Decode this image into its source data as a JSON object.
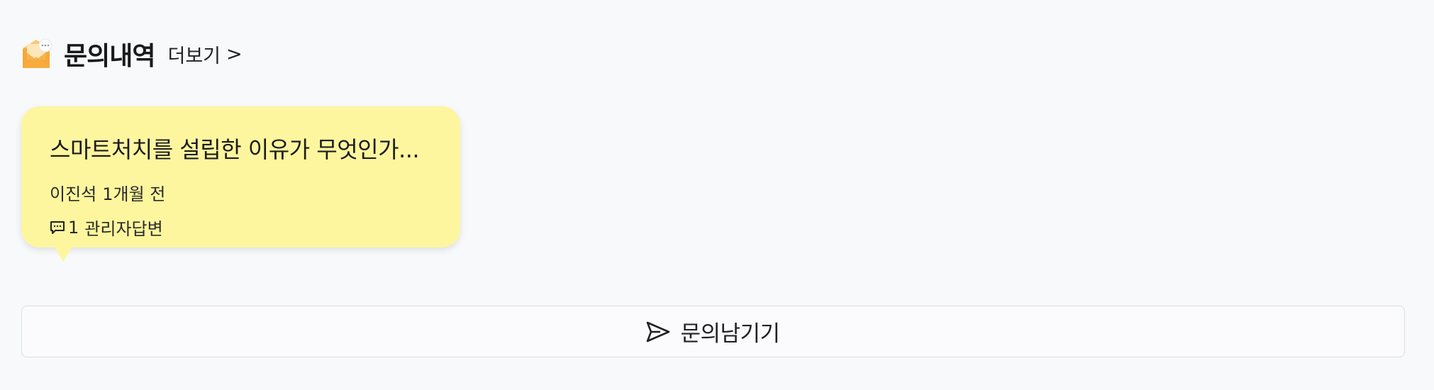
{
  "section": {
    "icon": "mail-with-message-icon",
    "title": "문의내역",
    "more_label": "더보기",
    "more_chevron": ">"
  },
  "inquiries": [
    {
      "title": "스마트처치를 설립한 이유가 무엇인가...",
      "author": "이진석",
      "time_ago": "1개월 전",
      "reply_icon": "comment-icon",
      "reply_count": "1",
      "reply_label": "관리자답변"
    }
  ],
  "ask_button": {
    "icon": "send-icon",
    "label": "문의남기기"
  },
  "colors": {
    "background": "#f8f9fb",
    "card": "#fef69e",
    "icon_orange": "#f6a93b"
  }
}
